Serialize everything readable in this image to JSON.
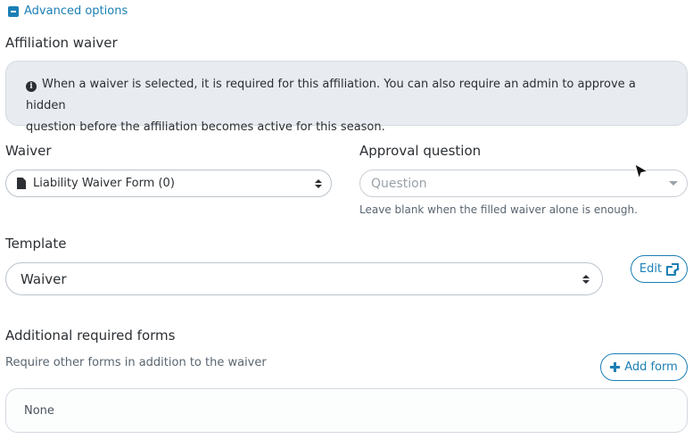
{
  "advanced": {
    "label": "Advanced options"
  },
  "affiliation_waiver": {
    "title": "Affiliation waiver",
    "info_line1": "When a waiver is selected, it is required for this affiliation. You can also require an admin to approve a hidden",
    "info_line2": "question before the affiliation becomes active for this season."
  },
  "waiver": {
    "label": "Waiver",
    "selected": "Liability Waiver Form (0)"
  },
  "approval": {
    "label": "Approval question",
    "placeholder": "Question",
    "help": "Leave blank when the filled waiver alone is enough."
  },
  "template": {
    "label": "Template",
    "selected": "Waiver",
    "edit_label": "Edit"
  },
  "additional_forms": {
    "title": "Additional required forms",
    "subtitle": "Require other forms in addition to the waiver",
    "add_label": "Add form",
    "empty_text": "None"
  },
  "colors": {
    "accent": "#1b7fb5",
    "info_bg": "#e8ecf1"
  },
  "icons": {
    "collapse": "minus-square-icon",
    "info": "info-circle-icon",
    "doc": "file-icon",
    "edit": "external-link-icon",
    "add": "plus-icon",
    "cursor": "mouse-pointer-icon"
  }
}
